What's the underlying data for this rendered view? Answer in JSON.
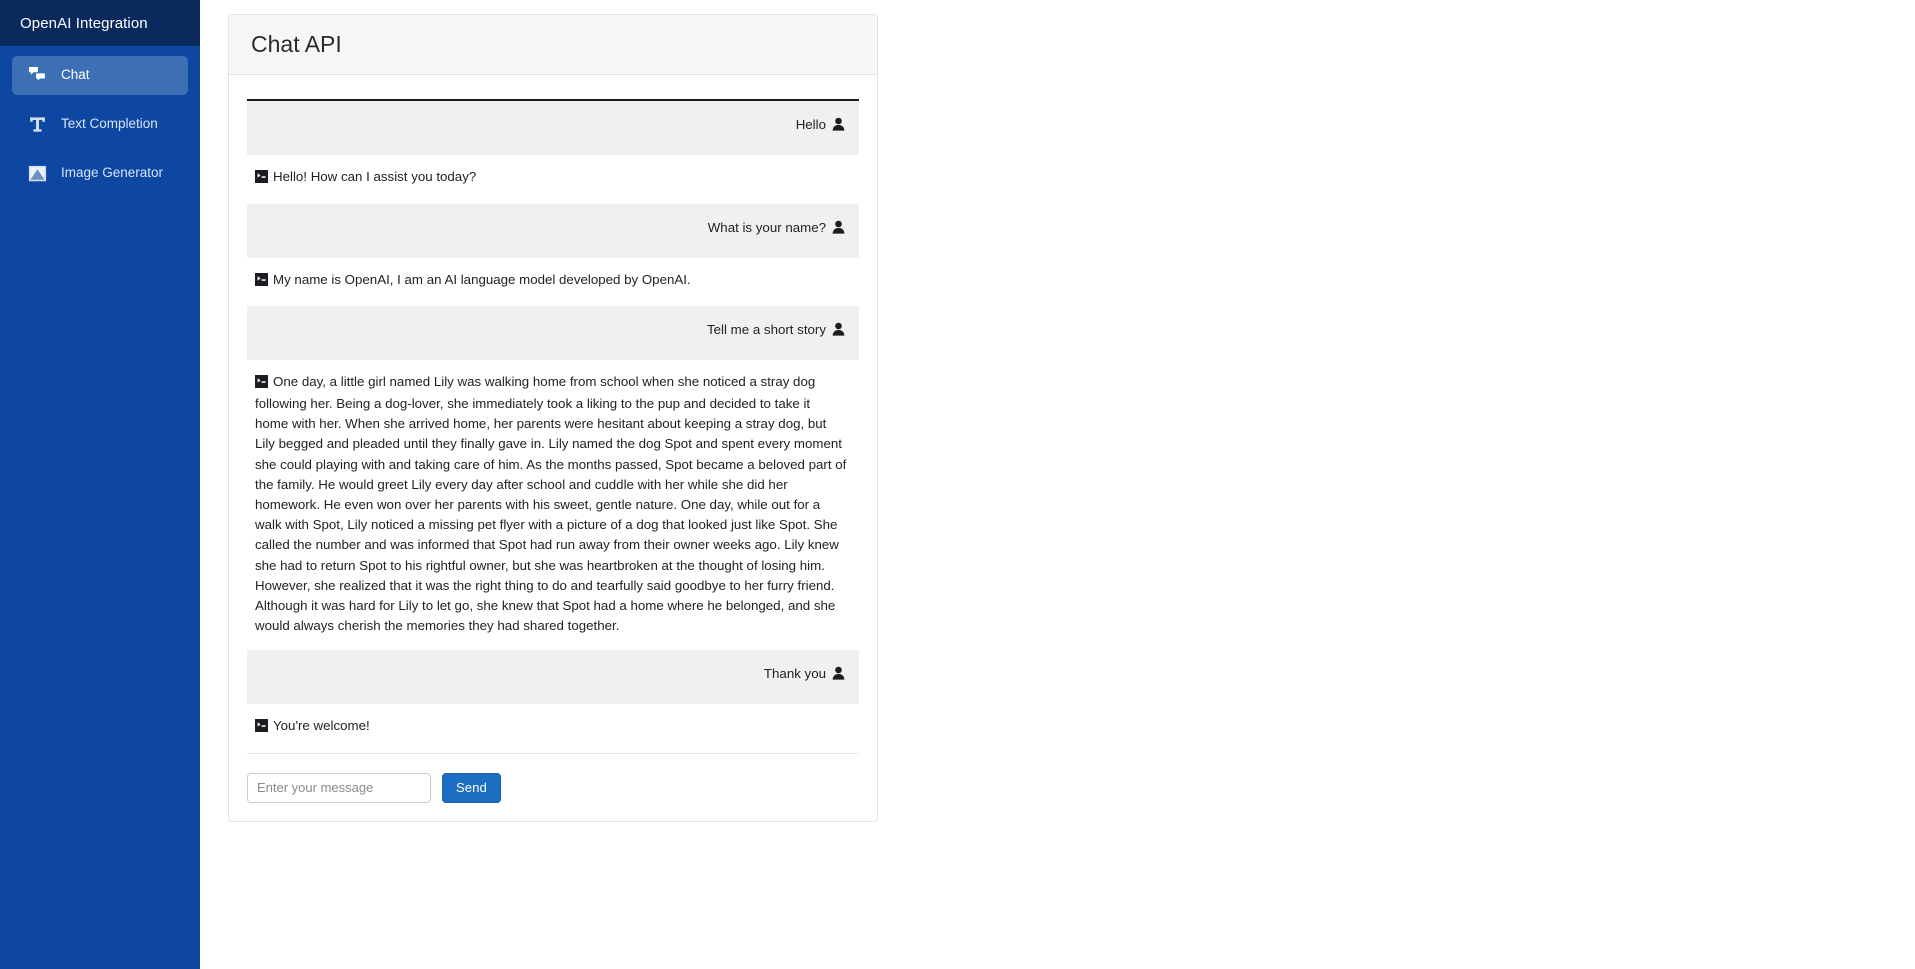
{
  "sidebar": {
    "brand": "OpenAI Integration",
    "items": [
      {
        "label": "Chat",
        "icon": "comments-icon",
        "active": true
      },
      {
        "label": "Text Completion",
        "icon": "text-t-icon",
        "active": false
      },
      {
        "label": "Image Generator",
        "icon": "image-icon",
        "active": false
      }
    ]
  },
  "main": {
    "card_title": "Chat API",
    "messages": [
      {
        "role": "user",
        "text": "Hello",
        "icon": "user-icon"
      },
      {
        "role": "bot",
        "text": "Hello! How can I assist you today?",
        "icon": "terminal-icon"
      },
      {
        "role": "user",
        "text": "What is your name?",
        "icon": "user-icon"
      },
      {
        "role": "bot",
        "text": "My name is OpenAI, I am an AI language model developed by OpenAI.",
        "icon": "terminal-icon"
      },
      {
        "role": "user",
        "text": "Tell me a short story",
        "icon": "user-icon"
      },
      {
        "role": "bot",
        "text": "One day, a little girl named Lily was walking home from school when she noticed a stray dog following her. Being a dog-lover, she immediately took a liking to the pup and decided to take it home with her. When she arrived home, her parents were hesitant about keeping a stray dog, but Lily begged and pleaded until they finally gave in. Lily named the dog Spot and spent every moment she could playing with and taking care of him. As the months passed, Spot became a beloved part of the family. He would greet Lily every day after school and cuddle with her while she did her homework. He even won over her parents with his sweet, gentle nature. One day, while out for a walk with Spot, Lily noticed a missing pet flyer with a picture of a dog that looked just like Spot. She called the number and was informed that Spot had run away from their owner weeks ago. Lily knew she had to return Spot to his rightful owner, but she was heartbroken at the thought of losing him. However, she realized that it was the right thing to do and tearfully said goodbye to her furry friend. Although it was hard for Lily to let go, she knew that Spot had a home where he belonged, and she would always cherish the memories they had shared together.",
        "icon": "terminal-icon"
      },
      {
        "role": "user",
        "text": "Thank you",
        "icon": "user-icon"
      },
      {
        "role": "bot",
        "text": "You're welcome!",
        "icon": "terminal-icon"
      }
    ],
    "input_placeholder": "Enter your message",
    "input_value": "",
    "send_label": "Send"
  },
  "colors": {
    "sidebar_bg": "#0d47a1",
    "sidebar_brand_bg": "#0a2a5e",
    "sidebar_active_bg": "#3d6fb4",
    "send_button_bg": "#1b6ec2",
    "user_msg_bg": "#f0f0f0",
    "card_header_bg": "#f7f7f7"
  }
}
